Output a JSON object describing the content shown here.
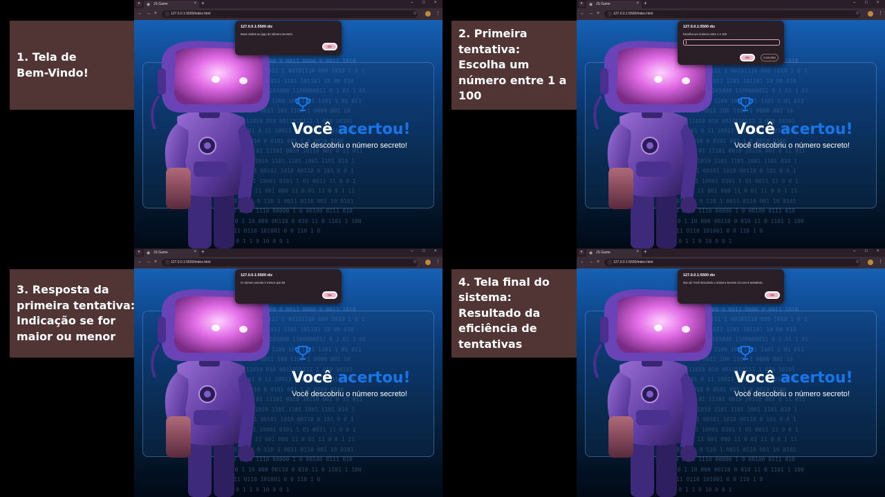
{
  "panels": [
    {
      "caption_lines": [
        "1. Tela de",
        "Bem-Vindo!"
      ],
      "tab_title": "JS Game",
      "url": "127.0.0.1:5500/index.html",
      "dialog": {
        "title": "127.0.0.1:5500 diz",
        "message": "Boas vindas ao jogo do número secreto!",
        "ok": "OK"
      }
    },
    {
      "caption_lines": [
        "2. Primeira",
        "tentativa:",
        "Escolha um",
        "número entre 1 a",
        "100"
      ],
      "tab_title": "JS Game",
      "url": "127.0.0.1:5500/index.html",
      "dialog": {
        "title": "127.0.0.1:5500 diz",
        "message": "Escolha um número entre 1 e 100",
        "ok": "OK",
        "cancel": "Cancelar",
        "input_value": ""
      }
    },
    {
      "caption_lines": [
        "3. Resposta da",
        "primeira tentativa:",
        "Indicação se for",
        "maior ou menor"
      ],
      "tab_title": "JS Game",
      "url": "127.0.0.1:5500/index.html",
      "dialog": {
        "title": "127.0.0.1:5500 diz",
        "message": "O número secreto é menor que 50.",
        "ok": "OK"
      }
    },
    {
      "caption_lines": [
        "4. Tela final do",
        "sistema:",
        "Resultado da",
        "eficiência de",
        "tentativas"
      ],
      "tab_title": "JS Game",
      "url": "127.0.0.1:5500/index.html",
      "dialog": {
        "title": "127.0.0.1:5500 diz",
        "message": "Isso aí! Você descobriu o número secreto 13 com 6 tentativas.",
        "ok": "OK"
      }
    }
  ],
  "game": {
    "title_prefix": "Você",
    "title_accent": "acertou!",
    "subtitle": "Você descobriu o número secreto!"
  },
  "binary_rows": [
    "   1 1 0   10 011 101 1011 1011 10110000 1",
    "  1010 0 1  110 100 0 0011 0000  0 0011 1010",
    "0 10100 0010111 1 00101110 000 1010 1  0 1",
    "  0000001101 000 1011 1101 101101 10 00 010",
    "1 00101111 001101000 1100000011 0 1 01 1 01",
    "  11 1 0 10110 1100 100 1101 1101 1  01 011",
    " 0110  1001101 0011 100 1100 1 0000 001 10",
    "   1  0101 11010 010 0011010111 1 010 10101",
    " 11010 01 0 11 10011 0 0101 1 1101 0 00 10",
    "   001 101 11010 0 0101 001 1 0 0010 0100",
    "110011011 01 11101 0010 10110 001 0 11 011",
    "   0  00110 1010 1101 1101 1001 1101 010 1",
    " 1 101 0 1011 00101 1010 00110 0 101 0 0 1",
    "  0 11010101 10001 0101 1 01 0011 11 0 0 1",
    "   1 0 101 11 001 000 11 0 01 11 0 0 1 11",
    " 101 00100 1 0 110 1 0011 0110 001 10 0101",
    "  1110 0000 1110 00000 1 0 00100 0111 010",
    "1  0 1 10 000 00110 0 010 11 0 1101 1 100",
    "     1   10111 0110 101001 0  0 110 1 0",
    "   1   0  0 1    1   0  10   0   0  1"
  ]
}
